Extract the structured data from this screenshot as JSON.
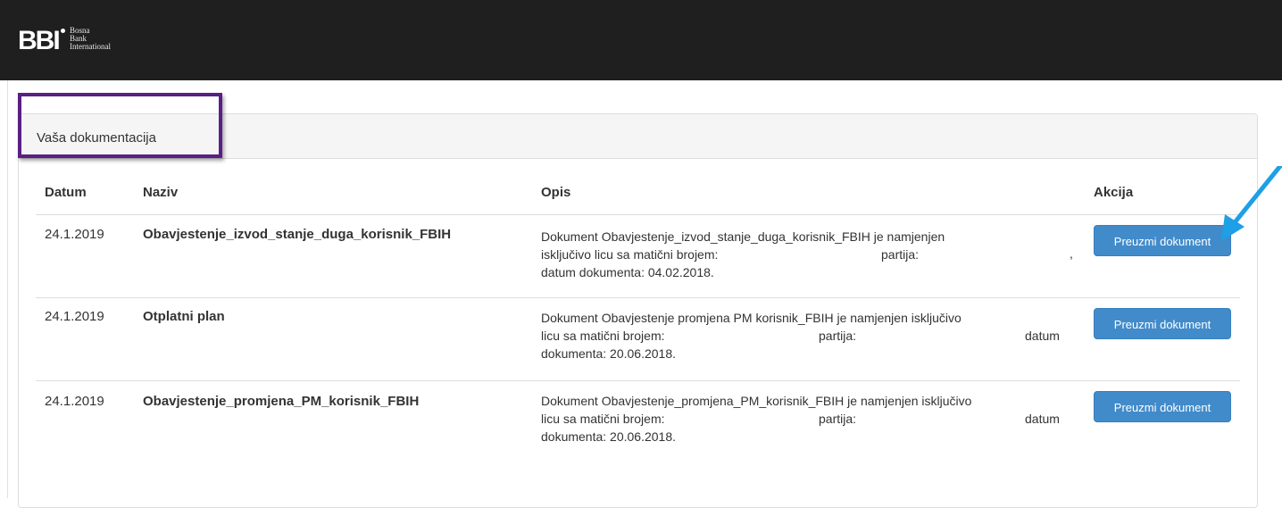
{
  "header": {
    "logo_mark": "BBI",
    "logo_line1": "Bosna",
    "logo_line2": "Bank",
    "logo_line3": "International"
  },
  "panel": {
    "title": "Vaša dokumentacija"
  },
  "table": {
    "columns": {
      "datum": "Datum",
      "naziv": "Naziv",
      "opis": "Opis",
      "akcija": "Akcija"
    },
    "rows": [
      {
        "datum": "24.1.2019",
        "naziv": "Obavjestenje_izvod_stanje_duga_korisnik_FBIH",
        "opis": {
          "l1": "Dokument Obavjestenje_izvod_stanje_duga_korisnik_FBIH je namjenjen",
          "l2a": "isključivo licu sa matični brojem:",
          "l2b": "partija:",
          "l2c": ",",
          "l3": "datum dokumenta: 04.02.2018."
        },
        "action": "Preuzmi dokument"
      },
      {
        "datum": "24.1.2019",
        "naziv": "Otplatni plan",
        "opis": {
          "l1": "Dokument Obavjestenje  promjena  PM  korisnik_FBIH je namjenjen isključivo",
          "l2a": "licu sa matični brojem:",
          "l2b": "partija:",
          "l2c": "datum",
          "l3": "dokumenta: 20.06.2018."
        },
        "action": "Preuzmi dokument"
      },
      {
        "datum": "24.1.2019",
        "naziv": "Obavjestenje_promjena_PM_korisnik_FBIH",
        "opis": {
          "l1": "Dokument Obavjestenje_promjena_PM_korisnik_FBIH je namjenjen isključivo",
          "l2a": "licu sa matični brojem:",
          "l2b": "partija:",
          "l2c": "datum",
          "l3": "dokumenta: 20.06.2018."
        },
        "action": "Preuzmi dokument"
      }
    ]
  },
  "colors": {
    "topbar": "#1f1f1f",
    "button": "#428bca",
    "highlight": "#5a1f87",
    "arrow": "#1e9fe6"
  }
}
